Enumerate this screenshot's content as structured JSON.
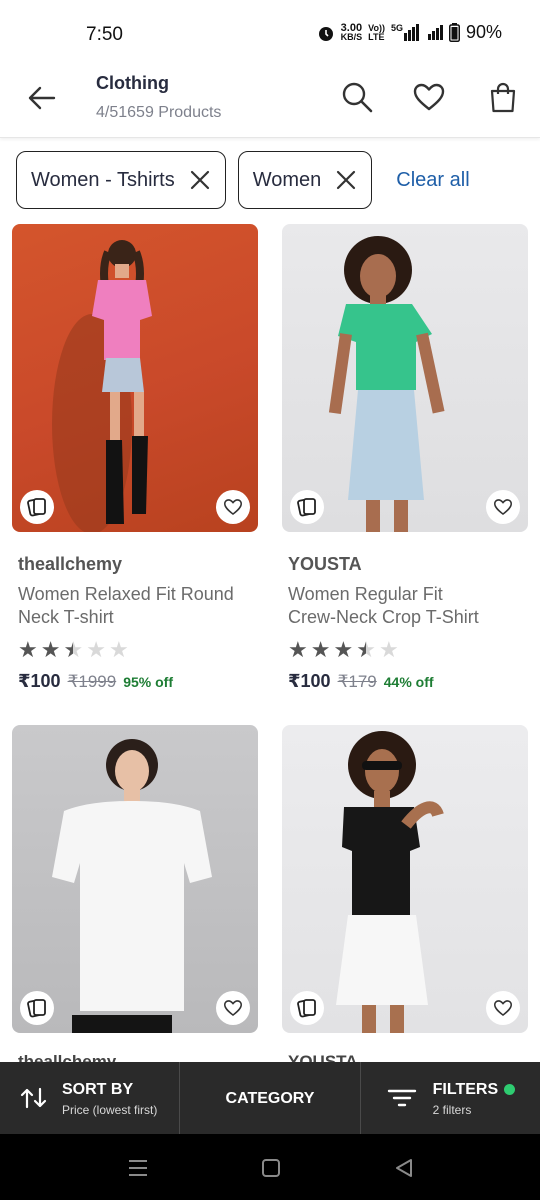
{
  "status_bar": {
    "time": "7:50",
    "speed_value": "3.00",
    "speed_unit": "KB/S",
    "volte_top": "Vo))",
    "volte_bottom": "LTE",
    "network": "5G",
    "battery": "90%"
  },
  "header": {
    "title": "Clothing",
    "subtitle": "4/51659 Products"
  },
  "filters": {
    "chips": [
      {
        "label": "Women - Tshirts"
      },
      {
        "label": "Women"
      }
    ],
    "clear_all": "Clear all"
  },
  "products": [
    {
      "brand": "theallchemy",
      "name_line1": "Women Relaxed Fit Round",
      "name_line2": "Neck T-shirt",
      "rating": 2.5,
      "price": "₹100",
      "mrp": "₹1999",
      "discount": "95% off"
    },
    {
      "brand": "YOUSTA",
      "name_line1": "Women Regular Fit",
      "name_line2": "Crew-Neck Crop T-Shirt",
      "rating": 3.5,
      "price": "₹100",
      "mrp": "₹179",
      "discount": "44% off"
    },
    {
      "brand": "theallchemy",
      "name_line1": "",
      "name_line2": "",
      "rating": 0,
      "price": "",
      "mrp": "",
      "discount": ""
    },
    {
      "brand": "YOUSTA",
      "name_line1": "",
      "name_line2": "",
      "rating": 0,
      "price": "",
      "mrp": "",
      "discount": ""
    }
  ],
  "bottom_bar": {
    "sort_title": "SORT BY",
    "sort_sub": "Price (lowest first)",
    "category": "CATEGORY",
    "filters_title": "FILTERS",
    "filters_sub": "2 filters"
  },
  "colors": {
    "accent_link": "#1f5fa8",
    "discount_green": "#1e7d34",
    "filter_dot": "#2ecc71",
    "action_bar_bg": "#2a2a2a"
  },
  "icons": [
    "back-arrow-icon",
    "search-icon",
    "wishlist-heart-icon",
    "shopping-bag-icon",
    "close-icon",
    "similar-cards-icon",
    "sort-arrows-icon",
    "filter-lines-icon"
  ]
}
